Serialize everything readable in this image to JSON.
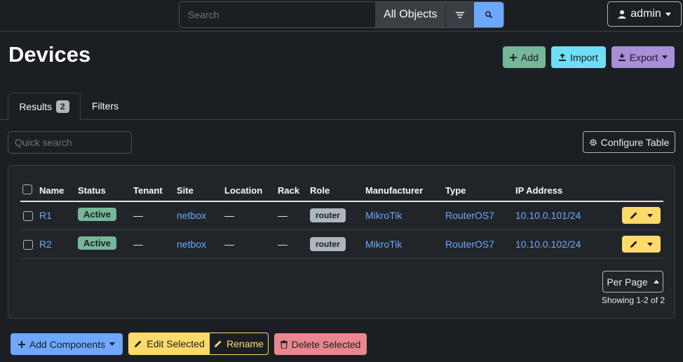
{
  "search": {
    "placeholder": "Search",
    "scope": "All Objects"
  },
  "user": {
    "name": "admin"
  },
  "page": {
    "title": "Devices"
  },
  "actions": {
    "add": "Add",
    "import": "Import",
    "export": "Export"
  },
  "tabs": {
    "results_label": "Results",
    "results_count": "2",
    "filters_label": "Filters"
  },
  "quick_search": {
    "placeholder": "Quick search"
  },
  "configure_table": "Configure Table",
  "table": {
    "headers": [
      "Name",
      "Status",
      "Tenant",
      "Site",
      "Location",
      "Rack",
      "Role",
      "Manufacturer",
      "Type",
      "IP Address"
    ],
    "rows": [
      {
        "name": "R1",
        "status": "Active",
        "tenant": "—",
        "site": "netbox",
        "location": "—",
        "rack": "—",
        "role": "router",
        "manufacturer": "MikroTik",
        "type": "RouterOS7",
        "ip": "10.10.0.101/24"
      },
      {
        "name": "R2",
        "status": "Active",
        "tenant": "—",
        "site": "netbox",
        "location": "—",
        "rack": "—",
        "role": "router",
        "manufacturer": "MikroTik",
        "type": "RouterOS7",
        "ip": "10.10.0.102/24"
      }
    ]
  },
  "pagination": {
    "per_page": "Per Page",
    "showing": "Showing 1-2 of 2"
  },
  "bulk": {
    "add_components": "Add Components",
    "edit_selected": "Edit Selected",
    "rename": "Rename",
    "delete_selected": "Delete Selected"
  },
  "colors": {
    "background": "#1b1f23",
    "primary": "#6ea8fe",
    "success": "#75b798",
    "info": "#6edff6",
    "purple": "#a98eda",
    "warning": "#ffda6a",
    "danger": "#ea868f"
  }
}
